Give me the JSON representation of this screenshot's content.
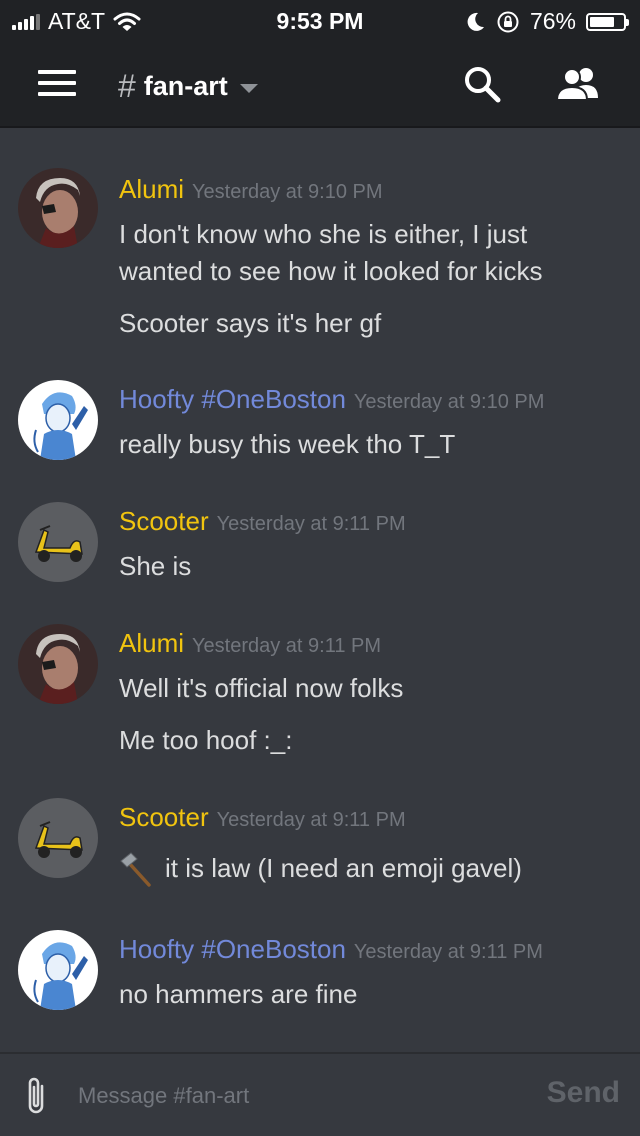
{
  "status_bar": {
    "carrier": "AT&T",
    "time": "9:53 PM",
    "battery": "76%",
    "battery_level": 0.76
  },
  "header": {
    "channel_name": "fan-art",
    "icons": [
      "menu-icon",
      "search-icon",
      "members-icon"
    ]
  },
  "colors": {
    "background": "#36393f",
    "header": "#202225",
    "name_yellow": "#f1c40f",
    "name_blue": "#7289da",
    "timestamp": "#72767d"
  },
  "messages": [
    {
      "author": "Alumi",
      "timestamp": "Yesterday at 9:10 PM",
      "lines": [
        "I don't know who she is either, I just",
        "wanted to see how it looked for kicks",
        "Scooter says it's her gf"
      ]
    },
    {
      "author": "Hoofty #OneBoston",
      "timestamp": "Yesterday at 9:10 PM",
      "lines": [
        "really busy this week tho T_T"
      ]
    },
    {
      "author": "Scooter",
      "timestamp": "Yesterday at 9:11 PM",
      "lines": [
        "She is"
      ]
    },
    {
      "author": "Alumi",
      "timestamp": "Yesterday at 9:11 PM",
      "lines": [
        "Well it's official now folks",
        "Me too hoof :_:"
      ]
    },
    {
      "author": "Scooter",
      "timestamp": "Yesterday at 9:11 PM",
      "lines": [
        "it is law (I need an emoji gavel)"
      ],
      "emoji": "hammer"
    },
    {
      "author": "Hoofty #OneBoston",
      "timestamp": "Yesterday at 9:11 PM",
      "lines": [
        "no hammers are fine"
      ]
    }
  ],
  "input": {
    "placeholder": "Message #fan-art",
    "send_label": "Send"
  }
}
